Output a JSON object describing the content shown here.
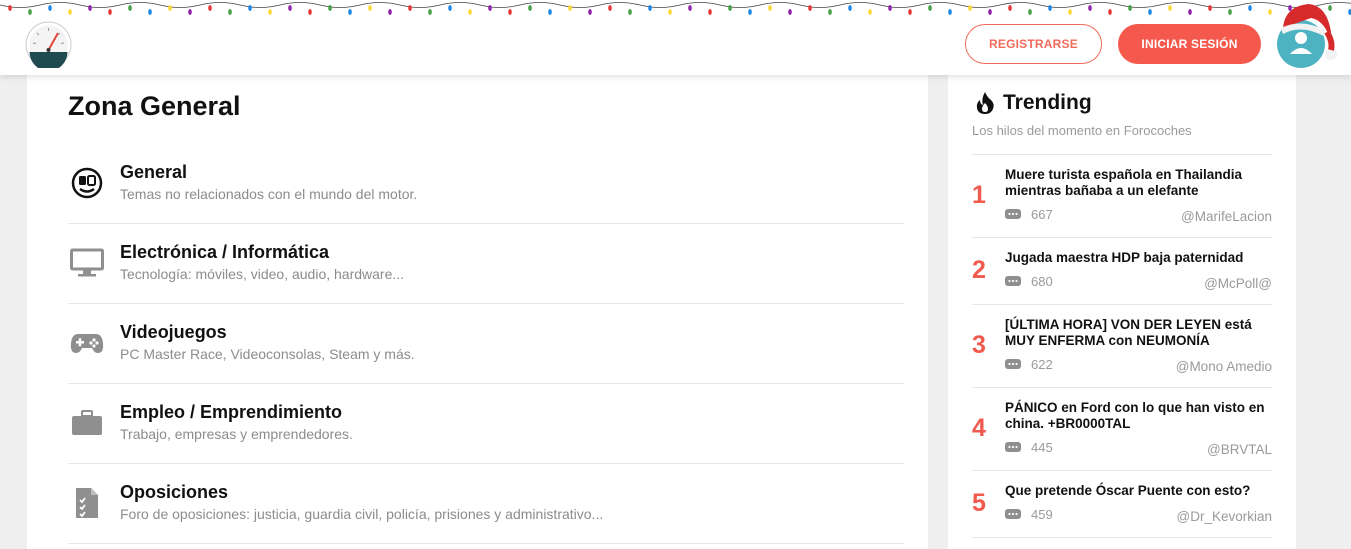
{
  "header": {
    "register_label": "REGISTRARSE",
    "login_label": "INICIAR SESIÓN",
    "accent_color": "#f5584d",
    "logo_icon": "speedometer-logo-icon",
    "avatar_icon": "user-avatar-santa-hat-icon"
  },
  "main": {
    "title": "Zona General",
    "forums": [
      {
        "icon": "general-face-icon",
        "name": "General",
        "description": "Temas no relacionados con el mundo del motor."
      },
      {
        "icon": "monitor-icon",
        "name": "Electrónica / Informática",
        "description": "Tecnología: móviles, video, audio, hardware..."
      },
      {
        "icon": "gamepad-icon",
        "name": "Videojuegos",
        "description": "PC Master Race, Videoconsolas, Steam y más."
      },
      {
        "icon": "briefcase-icon",
        "name": "Empleo / Emprendimiento",
        "description": "Trabajo, empresas y emprendedores."
      },
      {
        "icon": "checklist-document-icon",
        "name": "Oposiciones",
        "description": "Foro de oposiciones: justicia, guardia civil, policía, prisiones y administrativo..."
      }
    ]
  },
  "trending": {
    "title": "Trending",
    "subtitle": "Los hilos del momento en Forocoches",
    "icon": "fire-icon",
    "number_color": "#f15a4d",
    "items": [
      {
        "rank": "1",
        "title": "Muere turista española en Thailandia mientras bañaba a un elefante",
        "comments": "667",
        "user": "@MarifeLacion"
      },
      {
        "rank": "2",
        "title": "Jugada maestra HDP baja paternidad",
        "comments": "680",
        "user": "@McPoll@"
      },
      {
        "rank": "3",
        "title": "[ÚLTIMA HORA] VON DER LEYEN está MUY ENFERMA con NEUMONÍA",
        "comments": "622",
        "user": "@Mono Amedio"
      },
      {
        "rank": "4",
        "title": "PÁNICO en Ford con lo que han visto en china. +BR0000TAL",
        "comments": "445",
        "user": "@BRVTAL"
      },
      {
        "rank": "5",
        "title": "Que pretende Óscar Puente con esto?",
        "comments": "459",
        "user": "@Dr_Kevorkian"
      }
    ]
  }
}
